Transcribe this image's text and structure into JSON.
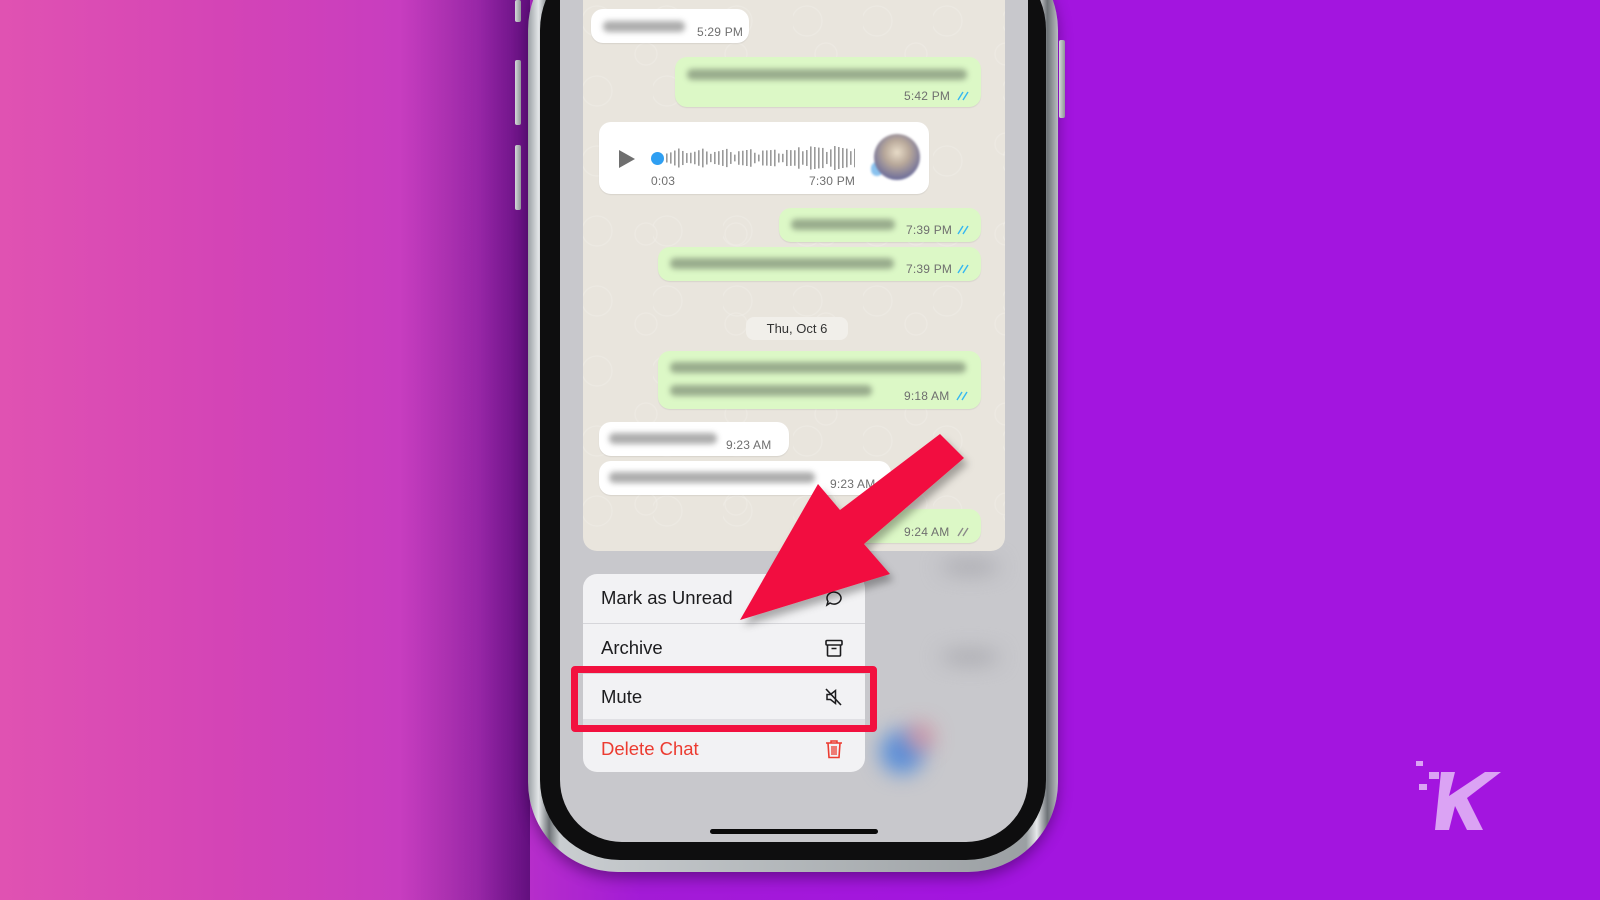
{
  "background": {
    "gradient_colors": [
      "#e052b2",
      "#c43bc2",
      "#a315df"
    ],
    "accent_annotation_color": "#f2113f"
  },
  "chat": {
    "messages": [
      {
        "direction": "in",
        "text_blurred": true,
        "time": "5:29 PM",
        "read": null
      },
      {
        "direction": "out",
        "text_blurred": true,
        "time": "5:42 PM",
        "read": true
      },
      {
        "direction": "in",
        "type": "voice",
        "duration": "0:03",
        "time": "7:30 PM"
      },
      {
        "direction": "out",
        "text_blurred": true,
        "time": "7:39 PM",
        "read": true
      },
      {
        "direction": "out",
        "text_blurred": true,
        "time": "7:39 PM",
        "read": true
      },
      {
        "direction": "out",
        "text_blurred": true,
        "time": "9:18 AM",
        "read": true
      },
      {
        "direction": "in",
        "text_blurred": true,
        "time": "9:23 AM",
        "read": null
      },
      {
        "direction": "in",
        "text_blurred": true,
        "time": "9:23 AM",
        "read": null
      },
      {
        "direction": "out",
        "text_blurred": true,
        "time": "9:24 AM",
        "read": false
      }
    ],
    "date_separator": "Thu, Oct 6",
    "read_tick_color": "#34b7f1",
    "unread_tick_color": "#8a8a8a"
  },
  "context_menu": {
    "items": [
      {
        "label": "Mark as Unread",
        "icon": "message-bubble-icon",
        "destructive": false
      },
      {
        "label": "Archive",
        "icon": "archive-box-icon",
        "destructive": false
      },
      {
        "label": "Mute",
        "icon": "speaker-muted-icon",
        "destructive": false,
        "highlighted": true
      },
      {
        "label": "Delete Chat",
        "icon": "trash-icon",
        "destructive": true
      }
    ],
    "destructive_color": "#ec3b30"
  },
  "watermark": {
    "letter": "K",
    "color": "#dba3f4"
  }
}
